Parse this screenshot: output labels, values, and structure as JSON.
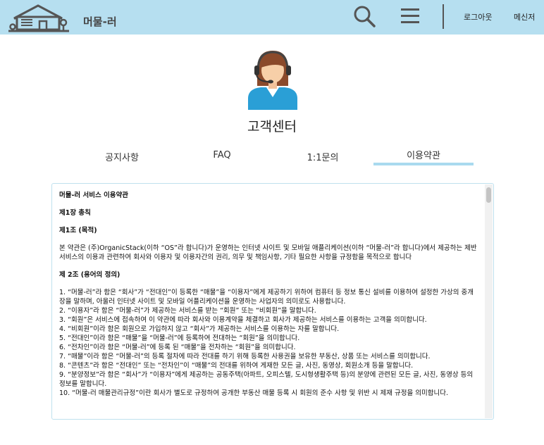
{
  "header": {
    "brand": "머물-러",
    "logout_label": "로그아웃",
    "messenger_label": "메신저",
    "background_color": "#b6dff0"
  },
  "icons": {
    "logo": "house-logo-icon",
    "search": "search-icon",
    "menu": "hamburger-menu-icon",
    "agent": "customer-service-agent-icon"
  },
  "page": {
    "title": "고객센터"
  },
  "tabs": [
    {
      "label": "공지사항",
      "active": false
    },
    {
      "label": "FAQ",
      "active": false
    },
    {
      "label": "1:1문의",
      "active": false
    },
    {
      "label": "이용약관",
      "active": true
    }
  ],
  "terms": {
    "heading": "머물-러 서비스 이용약관",
    "chapter1": "제1장 총칙",
    "article1": "제1조 (목적)",
    "article1_body": "본 약관은 (주)OrganicStack(이하 “OS”라 합니다)가 운영하는 인터넷 사이트 및 모바일 애플리케이션(이하 “머물-러”라 합니다)에서 제공하는 제반 서비스의 이용과 관련하여 회사와 이용자 및 이용자간의 권리, 의무 및 책임사항, 기타 필요한 사항을 규정함을 목적으로 합니다",
    "article2": "제 2조 (용어의 정의)",
    "definitions": [
      "1. “머물-러”라 함은 “회사”가 “전대인”이 등록한 “매물”을 “이용자”에게 제공하기 위하여 컴퓨터 등 정보 통신 설비를 이용하여 설정한 가상의 중개장을 말하며, 아울러 인터넷 사이트 및 모바일 어플리케이션을 운영하는 사업자의 의미로도 사용합니다.",
      "2. “이용자”라 함은 “머물-러”가 제공하는 서비스를 받는 “회원” 또는 “비회원”을 말합니다.",
      "3. “회원”은 서비스에 접속하여 이 약관에 따라 회사와 이용계약을 체결하고 회사가 제공하는 서비스를 이용하는 고객을 의미합니다.",
      "4. “비회원”이라 함은 회원으로 가입하지 않고 “회사”가 제공하는 서비스를 이용하는 자를 말합니다.",
      "5. “전대인”이라 함은 “매물”을 “머물-러”에 등록하여 전대하는 “회원”을 의미합니다.",
      "6. “전차인”이라 함은 “머물-러”에 등록 된 “매물”을 전차하는 “회원”을 의미합니다.",
      "7. “매물”이라 함은 “머물-러”의 등록 절차에 따라 전대를 하기 위해 등록한 사용권을 보유한 부동산, 상품 또는 서비스를 의미합니다.",
      "8. “콘텐츠”라 함은 “전대인” 또는 “전차인”이 “매물”의 전대를 위하여 게재한 모든 글, 사진, 동영상, 회원소개 등을 말합니다.",
      "9. “분양정보”라 함은 “회사”가 “이용자”에게 제공하는 공동주택(아파트, 오피스텔, 도시형생활주택 등)의 분양에 관련된 모든 글, 사진, 동영상 등의 정보를 말합니다.",
      "10. “머물-러 매물관리규정”이란 회사가 별도로 규정하여 공개한 부동산 매물 등록 시 회원의 준수 사항 및 위반 시 제재 규정을 의미합니다."
    ]
  }
}
